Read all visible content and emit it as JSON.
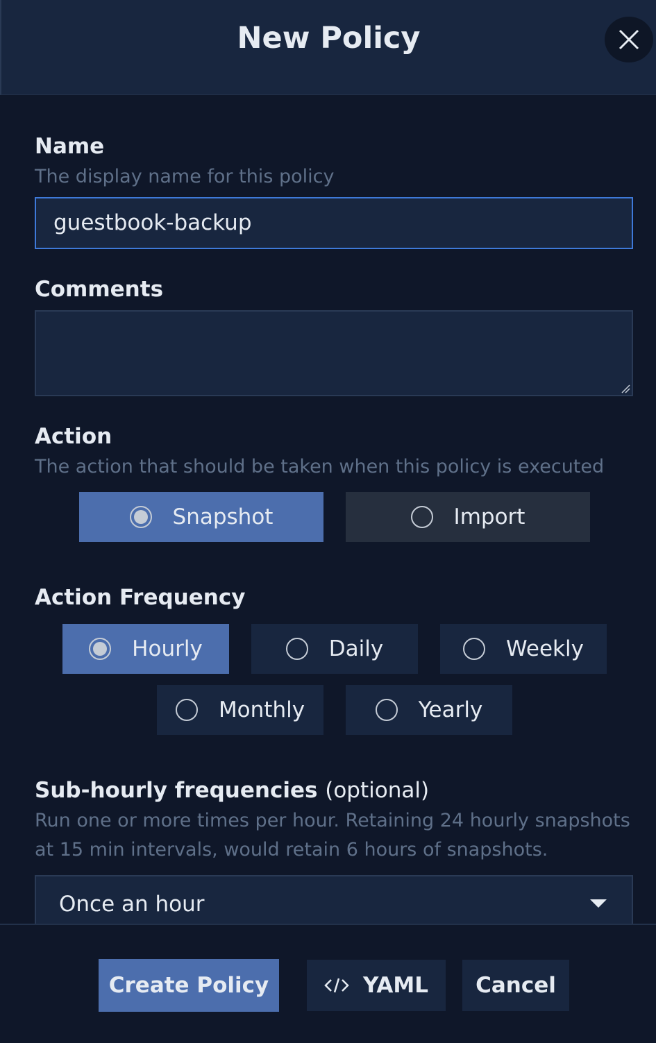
{
  "dialog": {
    "title": "New Policy",
    "close_icon": "close-icon"
  },
  "name_field": {
    "label": "Name",
    "help": "The display name for this policy",
    "value": "guestbook-backup"
  },
  "comments_field": {
    "label": "Comments",
    "value": ""
  },
  "action": {
    "label": "Action",
    "help": "The action that should be taken when this policy is executed",
    "options": [
      "Snapshot",
      "Import"
    ],
    "selected": "Snapshot"
  },
  "frequency": {
    "label": "Action Frequency",
    "options": [
      "Hourly",
      "Daily",
      "Weekly",
      "Monthly",
      "Yearly"
    ],
    "selected": "Hourly"
  },
  "sub_hourly": {
    "label": "Sub-hourly frequencies",
    "optional": "(optional)",
    "help_line1": "Run one or more times per hour. Retaining 24 hourly snapshots",
    "help_line2": "at 15 min intervals, would retain 6 hours of snapshots.",
    "selected_value": "Once an hour"
  },
  "footer": {
    "create_label": "Create Policy",
    "yaml_label": "YAML",
    "cancel_label": "Cancel"
  },
  "colors": {
    "background": "#0f1729",
    "panel": "#18263f",
    "accent": "#4c6ead",
    "focus_border": "#3e79d9",
    "help_text": "#5f7089"
  }
}
